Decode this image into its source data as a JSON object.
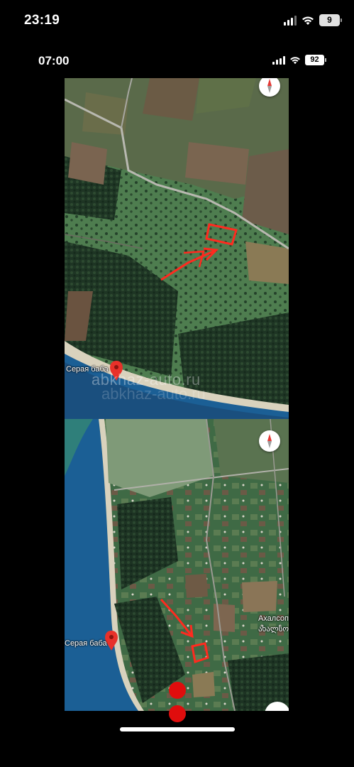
{
  "status_bar": {
    "time": "23:19",
    "battery": "9",
    "battery_color": "#e1e1e1"
  },
  "inner_status_bar": {
    "time": "07:00",
    "battery": "92"
  },
  "map_top": {
    "place_label": "Серая баба",
    "watermark": "abkhaz-auto.ru",
    "compass_icon": "compass-icon",
    "marker_icon": "map-pin-icon",
    "annotation_color": "#ff2a1f"
  },
  "map_bottom": {
    "place_label": "Серая баба",
    "village_label_ru": "Ахалсоп",
    "village_label_ka": "ახალსო",
    "compass_icon": "compass-icon",
    "marker_icon": "map-pin-icon",
    "annotation_color": "#ff2a1f"
  },
  "colors": {
    "sea": "#1b5f95",
    "field": "#4d7a4c",
    "forest": "#1f3a24",
    "road": "#b8b8b0",
    "red_dots": "#e00d0d"
  }
}
